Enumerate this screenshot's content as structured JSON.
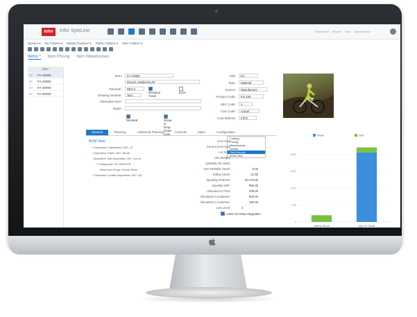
{
  "app": {
    "logo": "infor",
    "title": "Infor SyteLine"
  },
  "top_right": [
    "Workbench",
    "Recent",
    "Help",
    "Administrator"
  ],
  "menubar": [
    "System ▾",
    "My Folders ▾",
    "Master Explorer ▾",
    "Public Folders ▾",
    "User Folders ▾"
  ],
  "tabs": [
    {
      "label": "Items *",
      "active": true
    },
    {
      "label": "Item Pricing",
      "active": false
    },
    {
      "label": "Item Warehouses",
      "active": false
    }
  ],
  "item_list": {
    "header": "Item",
    "rows": [
      {
        "n": "1>",
        "v": "FA-10000",
        "selected": true
      },
      {
        "n": "2>",
        "v": "FA-20000",
        "selected": false
      },
      {
        "n": "3>",
        "v": "FA-30000",
        "selected": false
      },
      {
        "n": "4>",
        "v": "FA-40000",
        "selected": false
      }
    ]
  },
  "form": {
    "item_label": "Item:",
    "item": "FA-10000",
    "desc": "Bicycle, Model-26,26\"",
    "revision_label": "Revision:",
    "revision": "REV-2",
    "revision_track": "Revision Track",
    "ecn": "ECN",
    "drawing_label": "Drawing Number:",
    "drawing": "Test",
    "alt_label": "Alternative Item:",
    "alt": "",
    "buyer_label": "Buyer:",
    "buyer": "",
    "stocked": "Stocked",
    "show_dropdown": "Show in Drop Down Lists",
    "um_label": "U/M:",
    "um": "EA",
    "type_label": "Type:",
    "type": "Material",
    "source_label": "Source:",
    "source": "Manufacture",
    "product_label": "Product Code:",
    "product": "FG-100",
    "abc_label": "ABC Code:",
    "abc": "A",
    "costcode_label": "Cost Code:",
    "costcode": "Actual",
    "costmethod_label": "Cost Method:",
    "costmethod": "FIFO"
  },
  "subtabs": [
    "General",
    "Planning",
    "Additional Planning",
    "Controls",
    "Sales",
    "Configuration"
  ],
  "dropdown_items": [
    {
      "label": "Costing",
      "highlight": false
    },
    {
      "label": "Pricing",
      "highlight": false
    },
    {
      "label": "Maintenance",
      "highlight": false
    },
    {
      "label": "Quality",
      "highlight": false
    },
    {
      "label": "Field Service",
      "highlight": true
    },
    {
      "label": "BOM View",
      "highlight": false
    }
  ],
  "bom": {
    "title": "BOM View",
    "lines": [
      "+ Operation: Fabrication | WC: 12",
      "+ Operation: Paint | WC: Booth",
      "- Operation: Sub-Assembly | WC: Line A",
      "+ Component: FA-10000-FB",
      "Resource Group: Frame Team",
      "+ Operation: Quality Inspection | WC: QC"
    ]
  },
  "stats": [
    {
      "label": "Unit Cost:",
      "value": ""
    },
    {
      "label": "Current Unit Cost:",
      "value": ""
    },
    {
      "label": "Lot Size:",
      "value": ""
    },
    {
      "label": "Unit Weight:",
      "value": ""
    },
    {
      "label": "Quantity On Hand:",
      "value": ""
    },
    {
      "label": "Non-Nettable Stock:",
      "value": "0.00"
    },
    {
      "label": "Safety Stock:",
      "value": "21.00"
    },
    {
      "label": "Quantity Ordered:",
      "value": "20,172.00"
    },
    {
      "label": "Quantity WIP:",
      "value": "692.00"
    },
    {
      "label": "Allocated to Prod:",
      "value": "208.00"
    },
    {
      "label": "Allocated to Customer:",
      "value": "503.00"
    },
    {
      "label": "Allocated to Customer:",
      "value": "180.00"
    },
    {
      "label": "Low Level:",
      "value": "2"
    }
  ],
  "active_integration": "Active for Data Integration",
  "chart_data": {
    "type": "bar",
    "categories": [
      "Safety Stock",
      "Qty On Hand"
    ],
    "series": [
      {
        "name": "Week",
        "color": "#3b8fdc",
        "values": [
          0,
          2050
        ]
      },
      {
        "name": "Dist",
        "color": "#7cc043",
        "values": [
          200,
          150
        ]
      }
    ],
    "ytick_labels": [
      "2000",
      "1500",
      "1000",
      "500",
      "0"
    ],
    "ylim": [
      0,
      2150
    ],
    "stacked": true
  },
  "colors": {
    "accent": "#1e78c8",
    "brand": "#d2232a"
  }
}
